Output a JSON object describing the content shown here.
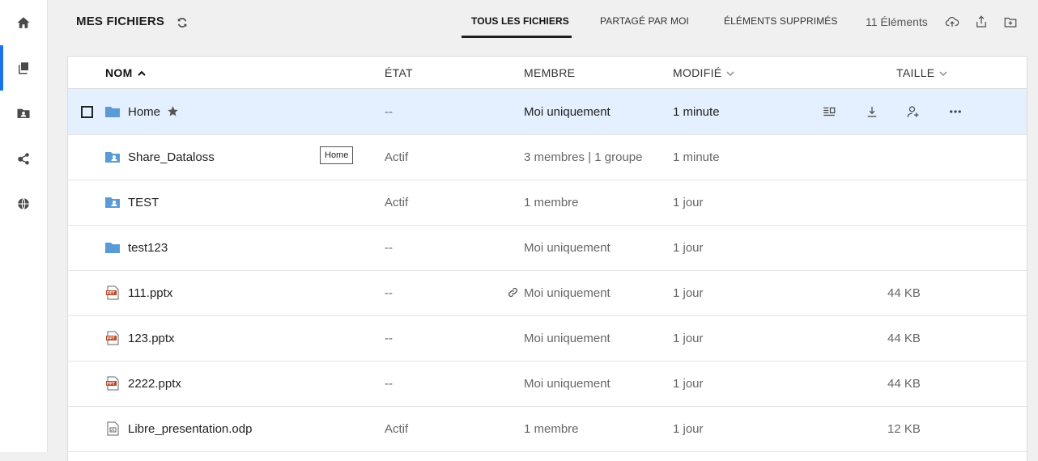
{
  "header": {
    "title": "MES FICHIERS",
    "tabs": [
      {
        "label": "TOUS LES FICHIERS",
        "active": true
      },
      {
        "label": "PARTAGÉ PAR MOI",
        "active": false
      },
      {
        "label": "ÉLÉMENTS SUPPRIMÉS",
        "active": false
      }
    ],
    "count": "11 Éléments"
  },
  "sidebar": {
    "items": [
      {
        "icon": "home-icon",
        "active": false
      },
      {
        "icon": "files-icon",
        "active": true
      },
      {
        "icon": "team-folders-icon",
        "active": false
      },
      {
        "icon": "share-icon",
        "active": false
      },
      {
        "icon": "globe-icon",
        "active": false
      }
    ]
  },
  "table": {
    "columns": [
      "NOM",
      "ÉTAT",
      "MEMBRE",
      "MODIFIÉ",
      "TAILLE"
    ],
    "rows": [
      {
        "name": "Home",
        "type": "folder",
        "state": "--",
        "member": "Moi uniquement",
        "modified": "1 minute",
        "size": ""
      },
      {
        "name": "Share_Dataloss",
        "type": "shared-folder",
        "state": "Actif",
        "member": "3 membres | 1 groupe",
        "modified": "1 minute",
        "size": ""
      },
      {
        "name": "TEST",
        "type": "shared-folder",
        "state": "Actif",
        "member": "1 membre",
        "modified": "1 jour",
        "size": ""
      },
      {
        "name": "test123",
        "type": "folder",
        "state": "--",
        "member": "Moi uniquement",
        "modified": "1 jour",
        "size": ""
      },
      {
        "name": "111.pptx",
        "type": "ppt",
        "state": "--",
        "member": "Moi uniquement",
        "modified": "1 jour",
        "size": "44 KB"
      },
      {
        "name": "123.pptx",
        "type": "ppt",
        "state": "--",
        "member": "Moi uniquement",
        "modified": "1 jour",
        "size": "44 KB"
      },
      {
        "name": "2222.pptx",
        "type": "ppt",
        "state": "--",
        "member": "Moi uniquement",
        "modified": "1 jour",
        "size": "44 KB"
      },
      {
        "name": "Libre_presentation.odp",
        "type": "odp",
        "state": "Actif",
        "member": "1 membre",
        "modified": "1 jour",
        "size": "12 KB"
      }
    ],
    "tooltip": "Home"
  },
  "colors": {
    "accent": "#1a73e8",
    "folder": "#5b9bd5",
    "selected_row": "#e4efff",
    "ppt": "#b7472a"
  }
}
